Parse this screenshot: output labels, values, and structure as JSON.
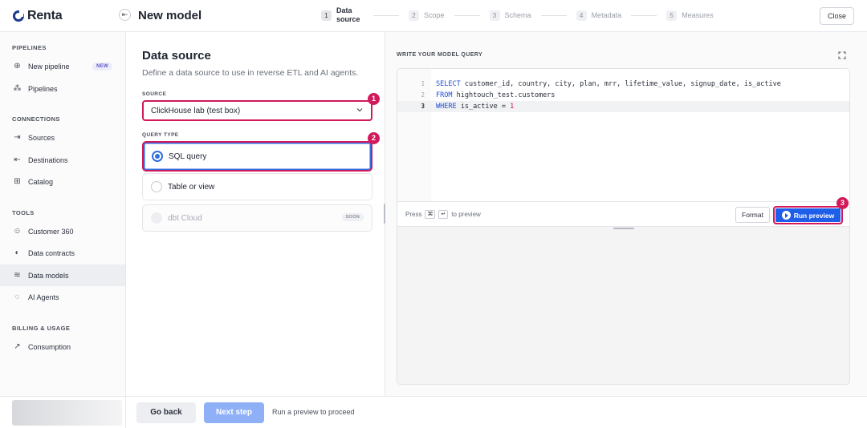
{
  "app": {
    "logo_text": "Renta",
    "page_title": "New model",
    "close_label": "Close"
  },
  "steps": [
    {
      "num": "1",
      "label": "Data source"
    },
    {
      "num": "2",
      "label": "Scope"
    },
    {
      "num": "3",
      "label": "Schema"
    },
    {
      "num": "4",
      "label": "Metadata"
    },
    {
      "num": "5",
      "label": "Measures"
    }
  ],
  "sidebar": {
    "sections": [
      "PIPELINES",
      "CONNECTIONS",
      "TOOLS",
      "BILLING & USAGE"
    ],
    "items": [
      {
        "label": "New pipeline",
        "icon": "plus-circle-icon",
        "badge": "NEW"
      },
      {
        "label": "Pipelines",
        "icon": "pipelines-icon"
      },
      {
        "label": "Sources",
        "icon": "sign-in-icon"
      },
      {
        "label": "Destinations",
        "icon": "sign-out-icon"
      },
      {
        "label": "Catalog",
        "icon": "grid-icon"
      },
      {
        "label": "Customer 360",
        "icon": "user-icon"
      },
      {
        "label": "Data contracts",
        "icon": "shield-icon"
      },
      {
        "label": "Data models",
        "icon": "database-icon",
        "active": true
      },
      {
        "label": "AI Agents",
        "icon": "chat-icon"
      },
      {
        "label": "Consumption",
        "icon": "chart-icon"
      }
    ]
  },
  "left": {
    "title": "Data source",
    "subtitle": "Define a data source to use in reverse ETL and AI agents.",
    "source_label": "SOURCE",
    "source_value": "ClickHouse lab (test box)",
    "query_type_label": "QUERY TYPE",
    "options": [
      {
        "label": "SQL query",
        "selected": true
      },
      {
        "label": "Table or view",
        "selected": false
      },
      {
        "label": "dbt Cloud",
        "disabled": true,
        "badge": "SOON"
      }
    ],
    "markers": [
      "1",
      "2",
      "3"
    ]
  },
  "editor": {
    "label": "WRITE YOUR MODEL QUERY",
    "lines": [
      {
        "n": "1",
        "text": "SELECT customer_id, country, city, plan, mrr, lifetime_value, signup_date, is_active"
      },
      {
        "n": "2",
        "text": "FROM hightouch_test.customers"
      },
      {
        "n": "3",
        "text": "WHERE is_active = 1"
      }
    ],
    "press_text": "Press",
    "key_cmd": "⌘",
    "key_enter": "↵",
    "to_preview_text": "to preview",
    "format_label": "Format",
    "run_label": "Run preview"
  },
  "footer": {
    "back_label": "Go back",
    "next_label": "Next step",
    "hint": "Run a preview to proceed"
  }
}
